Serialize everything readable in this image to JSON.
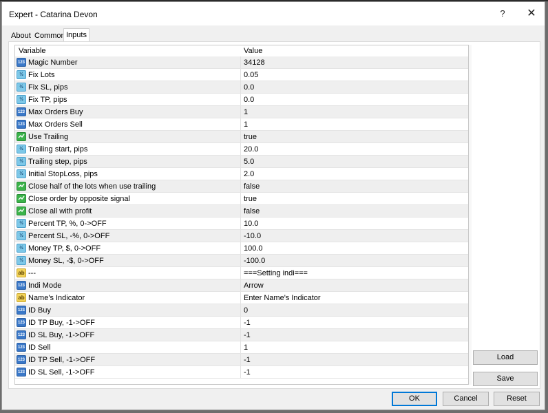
{
  "window": {
    "title": "Expert - Catarina Devon",
    "help_label": "?",
    "close_label": "✕"
  },
  "tabs": [
    {
      "label": "About",
      "active": false
    },
    {
      "label": "Common",
      "active": false
    },
    {
      "label": "Inputs",
      "active": true
    }
  ],
  "table": {
    "headers": {
      "variable": "Variable",
      "value": "Value"
    },
    "rows": [
      {
        "type": "int",
        "icon": "integer-type-icon",
        "icon_text": "123",
        "name": "Magic Number",
        "value": "34128"
      },
      {
        "type": "dbl",
        "icon": "double-type-icon",
        "icon_text": "½",
        "name": "Fix Lots",
        "value": "0.05"
      },
      {
        "type": "dbl",
        "icon": "double-type-icon",
        "icon_text": "½",
        "name": "Fix SL, pips",
        "value": "0.0"
      },
      {
        "type": "dbl",
        "icon": "double-type-icon",
        "icon_text": "½",
        "name": "Fix TP, pips",
        "value": "0.0"
      },
      {
        "type": "int",
        "icon": "integer-type-icon",
        "icon_text": "123",
        "name": "Max Orders Buy",
        "value": "1"
      },
      {
        "type": "int",
        "icon": "integer-type-icon",
        "icon_text": "123",
        "name": "Max Orders Sell",
        "value": "1"
      },
      {
        "type": "bool",
        "icon": "boolean-type-icon",
        "icon_text": "",
        "name": "Use Trailing",
        "value": "true"
      },
      {
        "type": "dbl",
        "icon": "double-type-icon",
        "icon_text": "½",
        "name": "Trailing start, pips",
        "value": "20.0"
      },
      {
        "type": "dbl",
        "icon": "double-type-icon",
        "icon_text": "½",
        "name": "Trailing step, pips",
        "value": "5.0"
      },
      {
        "type": "dbl",
        "icon": "double-type-icon",
        "icon_text": "½",
        "name": "Initial StopLoss, pips",
        "value": "2.0"
      },
      {
        "type": "bool",
        "icon": "boolean-type-icon",
        "icon_text": "",
        "name": "Close half of the lots when use trailing",
        "value": "false"
      },
      {
        "type": "bool",
        "icon": "boolean-type-icon",
        "icon_text": "",
        "name": "Close order by opposite signal",
        "value": "true"
      },
      {
        "type": "bool",
        "icon": "boolean-type-icon",
        "icon_text": "",
        "name": "Close all with profit",
        "value": "false"
      },
      {
        "type": "dbl",
        "icon": "double-type-icon",
        "icon_text": "½",
        "name": "Percent TP, %, 0->OFF",
        "value": "10.0"
      },
      {
        "type": "dbl",
        "icon": "double-type-icon",
        "icon_text": "½",
        "name": "Percent SL, -%, 0->OFF",
        "value": "-10.0"
      },
      {
        "type": "dbl",
        "icon": "double-type-icon",
        "icon_text": "½",
        "name": "Money TP, $, 0->OFF",
        "value": "100.0"
      },
      {
        "type": "dbl",
        "icon": "double-type-icon",
        "icon_text": "½",
        "name": "Money SL, -$, 0->OFF",
        "value": "-100.0"
      },
      {
        "type": "str",
        "icon": "string-type-icon",
        "icon_text": "ab",
        "name": "---",
        "value": "===Setting indi==="
      },
      {
        "type": "int",
        "icon": "integer-type-icon",
        "icon_text": "123",
        "name": "Indi Mode",
        "value": "Arrow"
      },
      {
        "type": "str",
        "icon": "string-type-icon",
        "icon_text": "ab",
        "name": "Name's Indicator",
        "value": "Enter Name's Indicator"
      },
      {
        "type": "int",
        "icon": "integer-type-icon",
        "icon_text": "123",
        "name": "ID Buy",
        "value": "0"
      },
      {
        "type": "int",
        "icon": "integer-type-icon",
        "icon_text": "123",
        "name": "ID TP Buy, -1->OFF",
        "value": "-1"
      },
      {
        "type": "int",
        "icon": "integer-type-icon",
        "icon_text": "123",
        "name": "ID SL Buy, -1->OFF",
        "value": "-1"
      },
      {
        "type": "int",
        "icon": "integer-type-icon",
        "icon_text": "123",
        "name": "ID Sell",
        "value": "1"
      },
      {
        "type": "int",
        "icon": "integer-type-icon",
        "icon_text": "123",
        "name": "ID TP Sell, -1->OFF",
        "value": "-1"
      },
      {
        "type": "int",
        "icon": "integer-type-icon",
        "icon_text": "123",
        "name": "ID SL Sell, -1->OFF",
        "value": "-1"
      }
    ]
  },
  "side_buttons": {
    "load": "Load",
    "save": "Save"
  },
  "footer_buttons": {
    "ok": "OK",
    "cancel": "Cancel",
    "reset": "Reset"
  },
  "colors": {
    "accent": "#0078d7",
    "alt_row": "#efefef"
  }
}
